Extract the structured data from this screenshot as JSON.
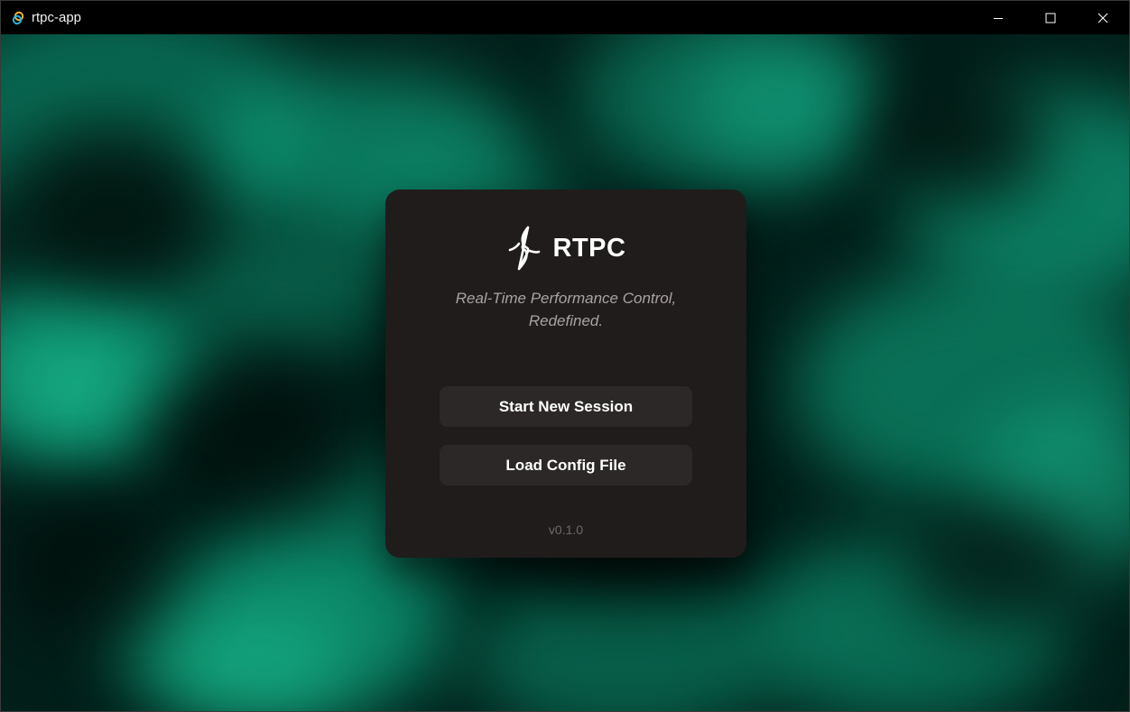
{
  "window": {
    "title": "rtpc-app",
    "app_icon": "rtpc-app-icon",
    "controls": {
      "minimize_icon": "minimize-icon",
      "maximize_icon": "maximize-icon",
      "close_icon": "close-icon"
    }
  },
  "colors": {
    "background_teal": "#00b88a",
    "card_background": "#201c1b",
    "button_background": "#2d2828",
    "tagline_color": "#a9a3a1",
    "version_color": "#6f6866"
  },
  "card": {
    "logo_icon": "rtpc-logo-icon",
    "brand_name": "RTPC",
    "tagline_line1": "Real-Time Performance Control,",
    "tagline_line2": "Redefined.",
    "buttons": {
      "start_label": "Start New Session",
      "load_label": "Load Config File"
    },
    "version": "v0.1.0"
  }
}
